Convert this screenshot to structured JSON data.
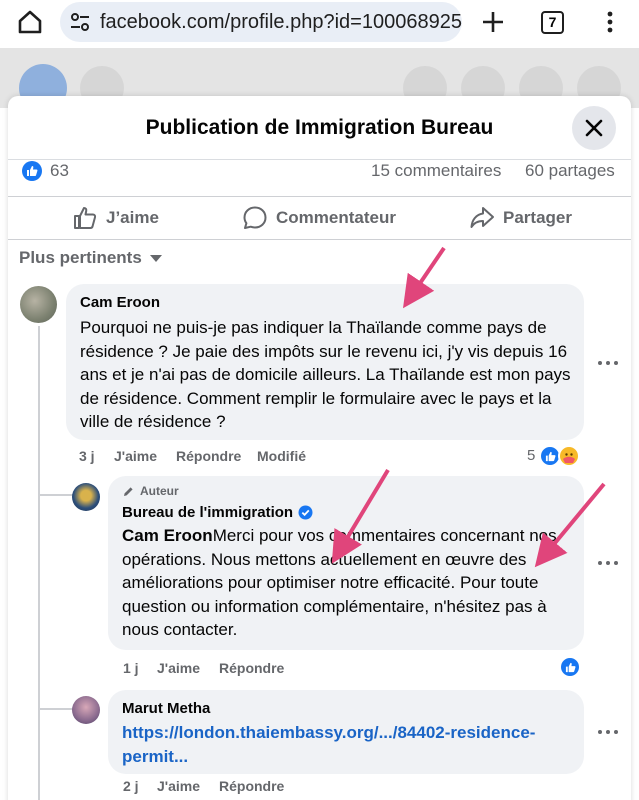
{
  "browser": {
    "url": "facebook.com/profile.php?id=100068925",
    "tab_count": "7"
  },
  "modal": {
    "title": "Publication de Immigration Bureau"
  },
  "stats": {
    "likes": "63",
    "comments": "15 commentaires",
    "shares": "60 partages"
  },
  "actions": {
    "like": "J’aime",
    "comment": "Commentateur",
    "share": "Partager"
  },
  "sort": {
    "label": "Plus pertinents"
  },
  "comments": [
    {
      "author": "Cam Eroon",
      "text": "Pourquoi ne puis-je pas indiquer la Thaïlande comme pays de résidence ? Je paie des impôts sur le revenu ici, j'y vis depuis 16 ans et je n'ai pas de domicile ailleurs. La Thaïlande est mon pays de résidence. Comment remplir le formulaire avec le pays et la ville de résidence ?",
      "time": "3 j",
      "like": "J'aime",
      "reply": "Répondre",
      "edited": "Modifié",
      "reaction_count": "5"
    },
    {
      "badge": "Auteur",
      "author": "Bureau de l'immigration",
      "mention": "Cam Eroon",
      "text": "Merci pour vos commentaires concernant nos opérations. Nous mettons actuellement en œuvre des améliorations pour optimiser notre efficacité. Pour toute question ou information complémentaire, n'hésitez pas à nous contacter.",
      "time": "1 j",
      "like": "J'aime",
      "reply": "Répondre"
    },
    {
      "author": "Marut Metha",
      "link": "https://london.thaiembassy.org/.../84402-residence-permit...",
      "time": "2 j",
      "like": "J'aime",
      "reply": "Répondre"
    }
  ],
  "colors": {
    "accent": "#1877f2",
    "arrow": "#e0457b",
    "bubble": "#f0f2f5",
    "link": "#1a64c6"
  }
}
